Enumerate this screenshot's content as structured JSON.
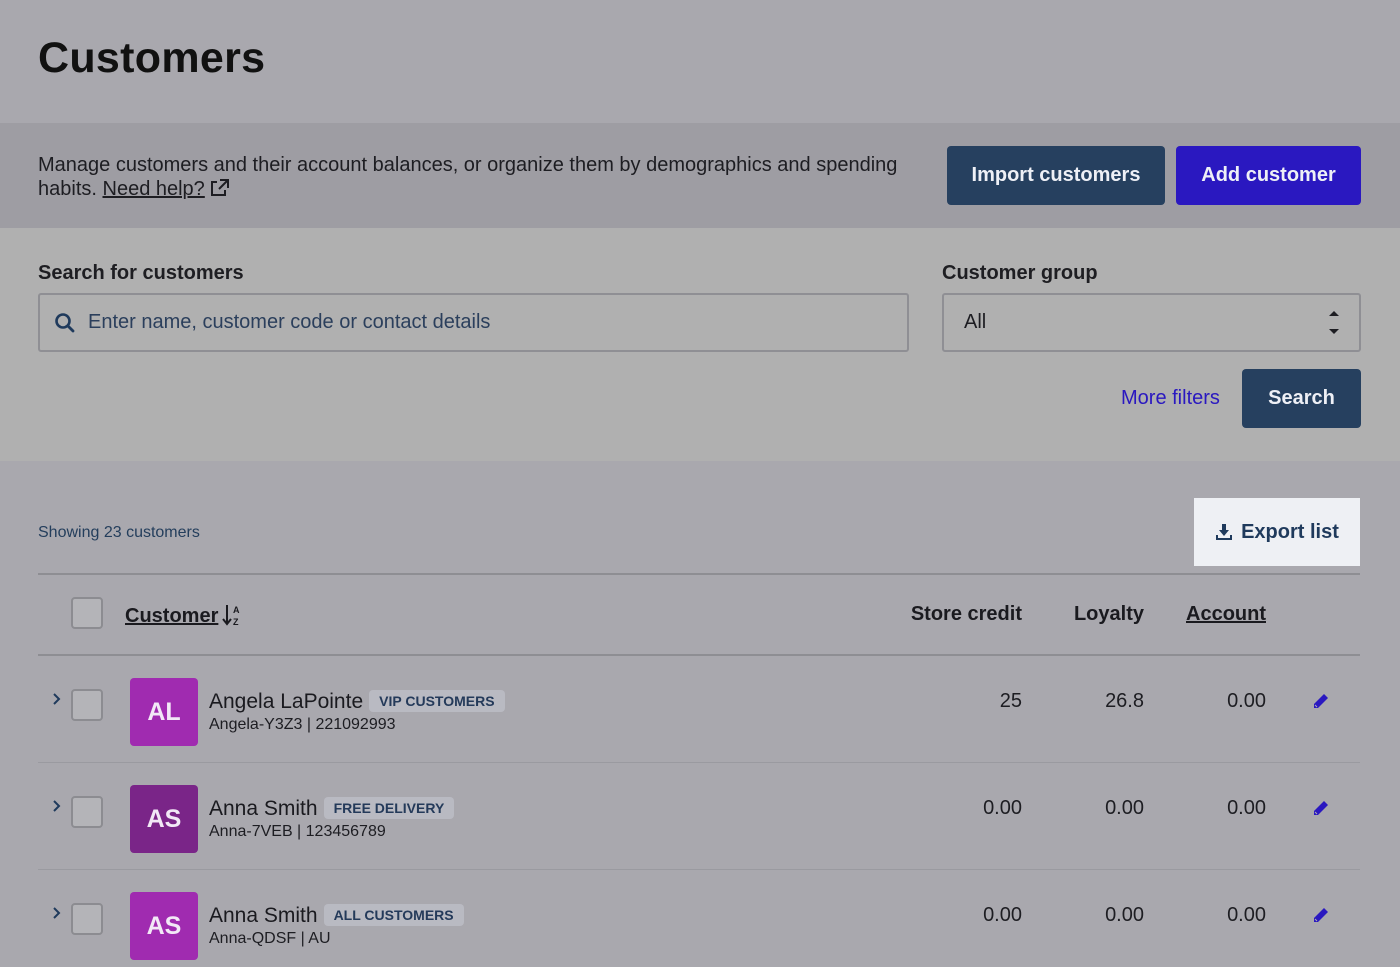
{
  "page": {
    "title": "Customers"
  },
  "intro": {
    "text": "Manage customers and their account balances, or organize them by demographics and spending habits.",
    "help_link": "Need help?",
    "import_button": "Import customers",
    "add_button": "Add customer"
  },
  "filters": {
    "search_label": "Search for customers",
    "search_placeholder": "Enter name, customer code or contact details",
    "group_label": "Customer group",
    "group_value": "All",
    "more_filters": "More filters",
    "search_button": "Search"
  },
  "results": {
    "showing": "Showing 23 customers",
    "export_button": "Export list"
  },
  "table": {
    "headers": {
      "customer": "Customer",
      "store_credit": "Store credit",
      "loyalty": "Loyalty",
      "account": "Account"
    },
    "rows": [
      {
        "initials": "AL",
        "avatar_color": "#a02bb0",
        "name": "Angela LaPointe",
        "tag": "VIP CUSTOMERS",
        "sub": "Angela-Y3Z3 | 221092993",
        "store_credit": "25",
        "loyalty": "26.8",
        "account": "0.00"
      },
      {
        "initials": "AS",
        "avatar_color": "#7a2588",
        "name": "Anna Smith",
        "tag": "FREE DELIVERY",
        "sub": "Anna-7VEB | 123456789",
        "store_credit": "0.00",
        "loyalty": "0.00",
        "account": "0.00"
      },
      {
        "initials": "AS",
        "avatar_color": "#a02bb0",
        "name": "Anna Smith",
        "tag": "ALL CUSTOMERS",
        "sub": "Anna-QDSF | AU",
        "store_credit": "0.00",
        "loyalty": "0.00",
        "account": "0.00"
      }
    ]
  },
  "icons": {
    "search": "search-icon",
    "external": "external-link-icon",
    "sort": "sort-alpha-icon",
    "export": "download-icon",
    "edit": "pencil-icon",
    "expand": "chevron-right-icon",
    "select": "select-arrows-icon"
  },
  "colors": {
    "primary": "#2a18c0",
    "navy": "#26405f"
  }
}
